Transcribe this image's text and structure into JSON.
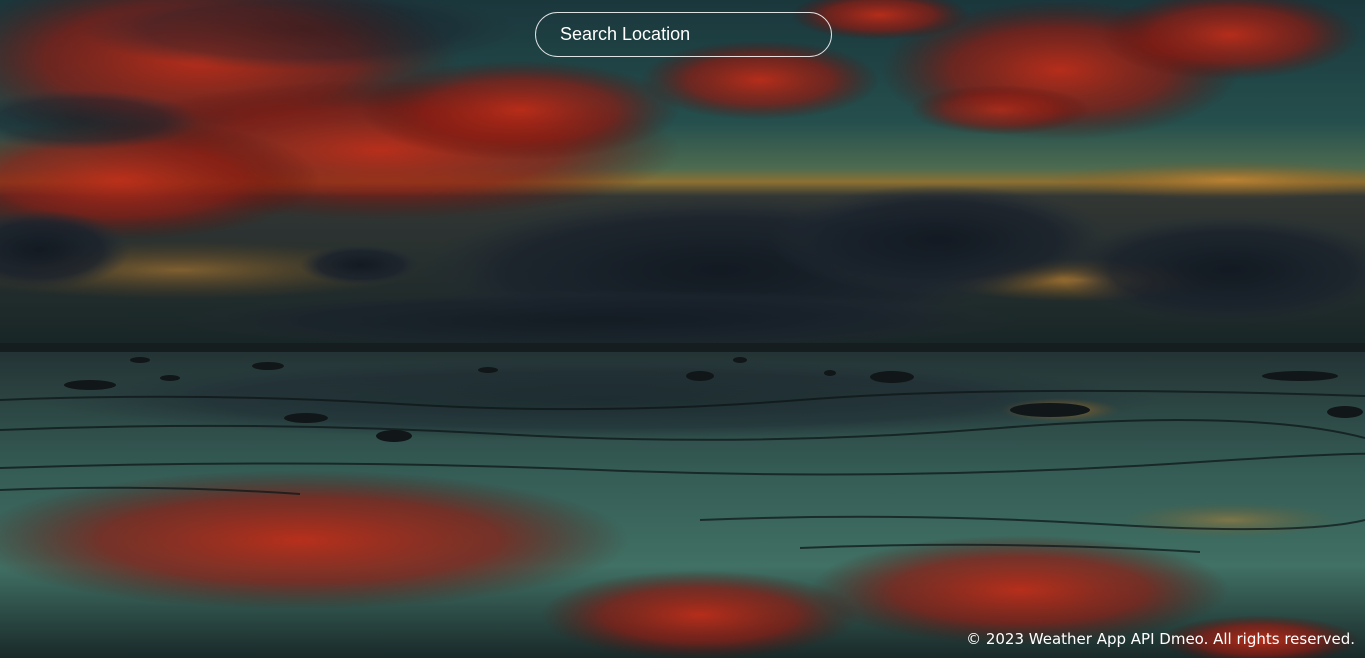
{
  "search": {
    "placeholder": "Search Location"
  },
  "footer": {
    "text": "© 2023 Weather App API Dmeo. All rights reserved."
  },
  "background": {
    "description_icon": "sunset-seascape-image",
    "colors": {
      "sky_teal": "#2a5a57",
      "cloud_red": "#b8261a",
      "cloud_dark": "#1c2530",
      "horizon_gold": "#c88a2a",
      "water_teal": "#3f7a6e"
    }
  }
}
